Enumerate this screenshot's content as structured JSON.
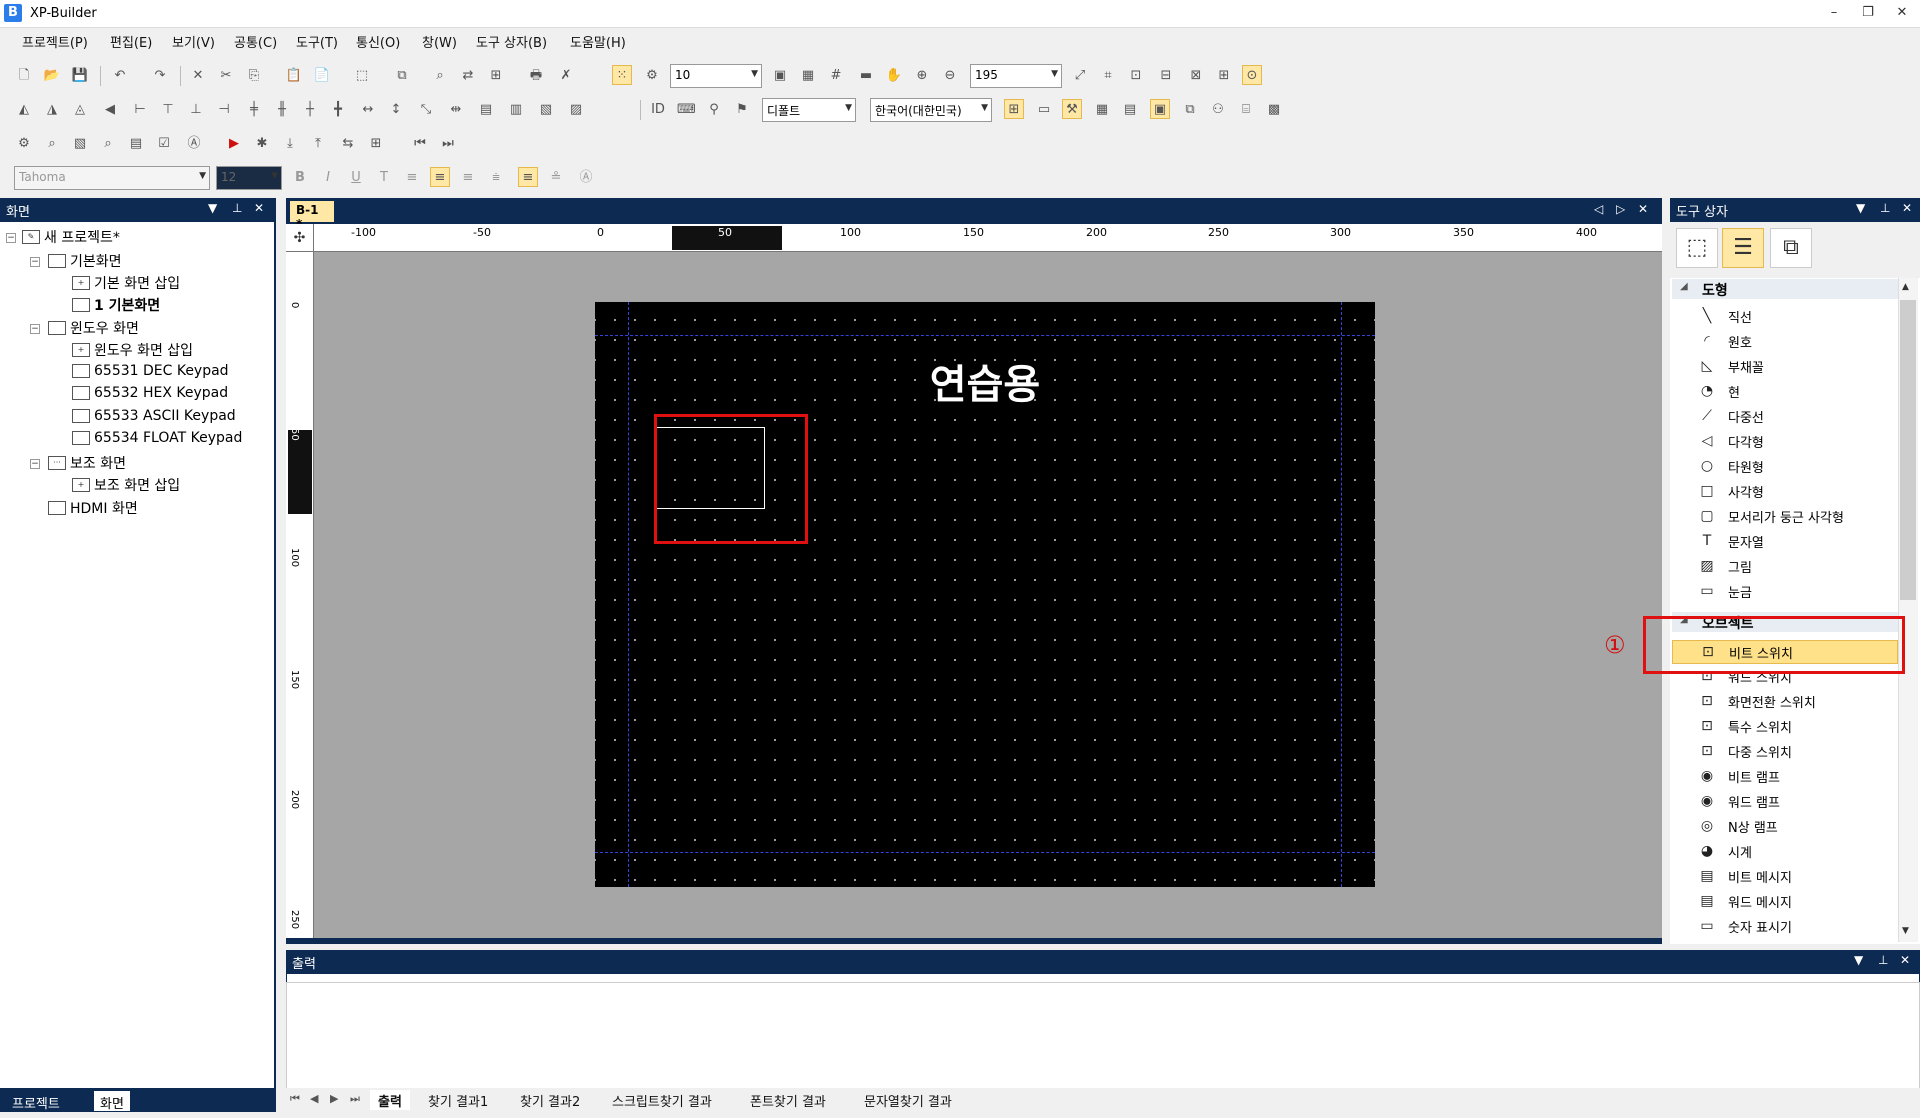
{
  "app": {
    "title": "XP-Builder",
    "icon_letter": "B",
    "minimize": "–",
    "restore": "❐",
    "close": "✕"
  },
  "menu": [
    "프로젝트(P)",
    "편집(E)",
    "보기(V)",
    "공통(C)",
    "도구(T)",
    "통신(O)",
    "창(W)",
    "도구 상자(B)",
    "도움말(H)"
  ],
  "toolbar": {
    "grid_size": "10",
    "zoom": "195",
    "font_style": "디폴트",
    "language": "한국어(대한민국)",
    "font_name": "Tahoma",
    "font_size": "12"
  },
  "left_panel": {
    "title": "화면",
    "tree": {
      "root": "새 프로젝트*",
      "basic_screen": "기본화면",
      "basic_insert": "기본 화면 삽입",
      "basic_1": "1 기본화면",
      "window_screen": "윈도우 화면",
      "window_insert": "윈도우 화면 삽입",
      "keypad_dec": "65531 DEC Keypad",
      "keypad_hex": "65532 HEX Keypad",
      "keypad_ascii": "65533 ASCII Keypad",
      "keypad_float": "65534 FLOAT Keypad",
      "aux_screen": "보조 화면",
      "aux_insert": "보조 화면 삽입",
      "hdmi": "HDMI 화면"
    },
    "tabs": [
      "프로젝트",
      "화면"
    ]
  },
  "document": {
    "tab": "B-1 *",
    "ruler_h_labels": [
      "-100",
      "-50",
      "0",
      "50",
      "100",
      "150",
      "200",
      "250",
      "300",
      "350",
      "400"
    ],
    "ruler_v_labels": [
      "0",
      "50",
      "100",
      "150",
      "200",
      "250"
    ],
    "screen_title": "연습용"
  },
  "toolbox": {
    "title": "도구 상자",
    "category_shapes": "도형",
    "shapes": [
      "직선",
      "원호",
      "부채꼴",
      "현",
      "다중선",
      "다각형",
      "타원형",
      "사각형",
      "모서리가 둥근 사각형",
      "문자열",
      "그림",
      "눈금"
    ],
    "category_objects": "오브젝트",
    "objects": [
      "비트 스위치",
      "워드 스위치",
      "화면전환 스위치",
      "특수 스위치",
      "다중 스위치",
      "비트 램프",
      "워드 램프",
      "N상 램프",
      "시계",
      "비트 메시지",
      "워드 메시지",
      "숫자 표시기"
    ],
    "annotation": "①"
  },
  "output": {
    "title": "출력",
    "tabs": [
      "출력",
      "찾기 결과1",
      "찾기 결과2",
      "스크립트찾기 결과",
      "폰트찾기 결과",
      "문자열찾기 결과"
    ]
  },
  "colors": {
    "panel_header": "#0d2a52",
    "selection": "#ffe18a",
    "highlight_red": "#e01010"
  }
}
